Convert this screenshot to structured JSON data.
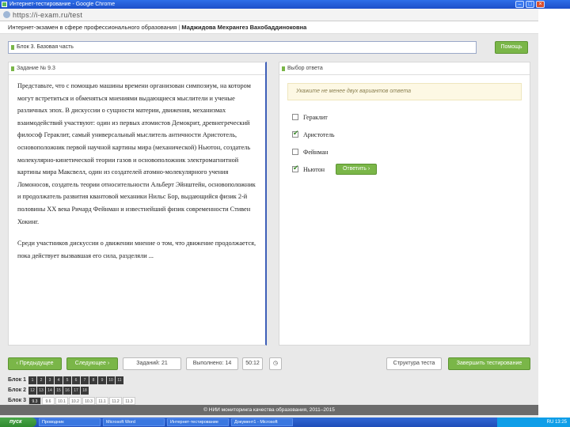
{
  "window": {
    "title": "Интернет-тестирование - Google Chrome",
    "url": "https://i-exam.ru/test"
  },
  "header": {
    "program": "Интернет-экзамен в сфере профессионального образования",
    "separator": "|",
    "student": "Маджидова Мехрангез Вахобаддиноковна"
  },
  "block_bar": {
    "label": "Блок 3. Базовая часть",
    "help_label": "Помощь"
  },
  "task": {
    "header": "Задание № 9.3",
    "paragraphs": [
      "Представьте, что с помощью машины времени организован симпозиум, на котором могут встретиться и обменяться мнениями выдающиеся мыслители и ученые различных эпох. В дискуссии о сущности материи, движения, механизмах взаимодействий участвуют: один из первых атомистов Демокрит, древнегреческий философ Гераклит, самый универсальный мыслитель античности Аристотель, основоположник первой научной картины мира (механической) Ньютон, создатель молекулярно-кинетической теории газов и основоположник электромагнитной картины мира Максвелл, один из создателей атомно-молекулярного учения Ломоносов, создатель теории относительности Альберт Эйнштейн, основоположник и продолжатель развития квантовой механики Нильс Бор, выдающийся физик 2-й половины XX века Ричард Фейнман и известнейший физик современности Стивен Хокинг.",
      "Среди участников дискуссии о движении мнение о том, что движение продолжается, пока действует вызвавшая его сила, разделяли ..."
    ]
  },
  "answer": {
    "header": "Выбор ответа",
    "notice": "Укажите не менее двух вариантов ответа",
    "options": [
      {
        "label": "Гераклит",
        "checked": false
      },
      {
        "label": "Аристотель",
        "checked": true
      },
      {
        "label": "Фейнман",
        "checked": false
      },
      {
        "label": "Ньютон",
        "checked": true
      }
    ],
    "submit_label": "Ответить"
  },
  "navigation": {
    "prev_label": "Предыдущее",
    "next_label": "Следующее",
    "task_counter": "Заданий: 21",
    "answered": "Выполнено: 14",
    "time": "50:12",
    "status_label": "Структура теста",
    "finish_label": "Завершить тестирование"
  },
  "blocks": [
    {
      "label": "Блок 1",
      "cells": [
        "1",
        "2",
        "3",
        "4",
        "5",
        "6",
        "7",
        "8",
        "9",
        "10",
        "11"
      ],
      "style": "dark"
    },
    {
      "label": "Блок 2",
      "cells": [
        "12",
        "13",
        "14",
        "15",
        "16",
        "17",
        "18"
      ],
      "style": "dark"
    },
    {
      "label": "Блок 3",
      "cells": [
        "9.3",
        "9.6",
        "10.1",
        "10.2",
        "10.3",
        "11.1",
        "11.2",
        "11.3"
      ],
      "style": "light",
      "active_index": 0
    }
  ],
  "footer": "© НИИ мониторинга качества образования, 2011–2015",
  "taskbar": {
    "start_label": "пуск",
    "items": [
      "Проводник",
      "Microsoft Word",
      "Интернет-тестирование",
      "Документ1 - Microsoft"
    ],
    "clock": "RU 13:25"
  }
}
